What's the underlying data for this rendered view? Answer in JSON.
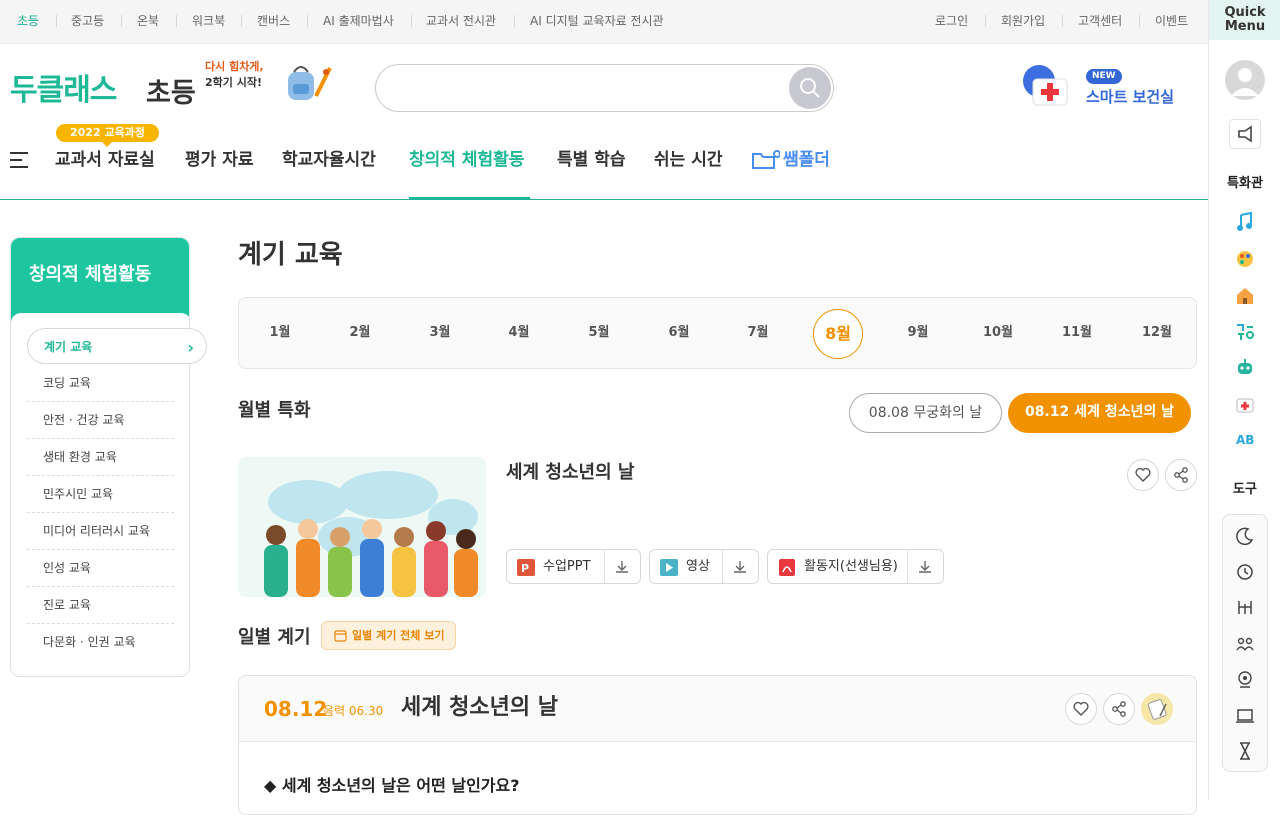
{
  "top_links": [
    "초등",
    "중고등",
    "온북",
    "워크북",
    "캔버스",
    "AI 출제마법사",
    "교과서 전시관",
    "AI 디지털 교육자료 전시관"
  ],
  "top_right": [
    "로그인",
    "회원가입",
    "고객센터",
    "이벤트"
  ],
  "logo": {
    "brand": "두클래스",
    "sub": "초등",
    "promo_line1": "다시 힘차게,",
    "promo_line2": "2학기 시작!"
  },
  "search": {
    "placeholder": ""
  },
  "health": {
    "badge": "NEW",
    "label": "스마트 보건실"
  },
  "nav": {
    "badge": "2022 교육과정",
    "items": [
      "교과서 자료실",
      "평가 자료",
      "학교자율시간",
      "창의적 체험활동",
      "특별 학습",
      "쉬는 시간"
    ],
    "special": "쌤폴더"
  },
  "quick_menu": {
    "title_line1": "Quick",
    "title_line2": "Menu",
    "special_label": "특화관",
    "tools_label": "도구",
    "special_icons": [
      "music-icon",
      "palette-icon",
      "school-icon",
      "hangul-icon",
      "robot-icon",
      "first-aid-icon",
      "english-icon"
    ],
    "tool_icons": [
      "moon-icon",
      "alarm-icon",
      "balance-icon",
      "group-icon",
      "roulette-icon",
      "screen-icon",
      "hourglass-icon"
    ]
  },
  "sidebar": {
    "title": "창의적 체험활동",
    "items": [
      "계기 교육",
      "코딩 교육",
      "안전 · 건강 교육",
      "생태 환경 교육",
      "민주시민 교육",
      "미디어 리터러시 교육",
      "인성 교육",
      "진로 교육",
      "다문화 · 인권 교육"
    ]
  },
  "page_title": "계기 교육",
  "months": [
    "1월",
    "2월",
    "3월",
    "4월",
    "5월",
    "6월",
    "7월",
    "8월",
    "9월",
    "10월",
    "11월",
    "12월"
  ],
  "monthly": {
    "label": "월별 특화",
    "pill_gray": "08.08 무궁화의 날",
    "pill_orange": "08.12 세계 청소년의 날",
    "content_title": "세계 청소년의 날",
    "downloads": [
      "수업PPT",
      "영상",
      "활동지(선생님용)"
    ]
  },
  "daily": {
    "label": "일별 계기",
    "calendar_btn": "일별 계기 전체 보기",
    "date": "08.12",
    "lunar": "음력 06.30",
    "title": "세계 청소년의 날",
    "question": "◆ 세계 청소년의 날은 어떤 날인가요?"
  }
}
